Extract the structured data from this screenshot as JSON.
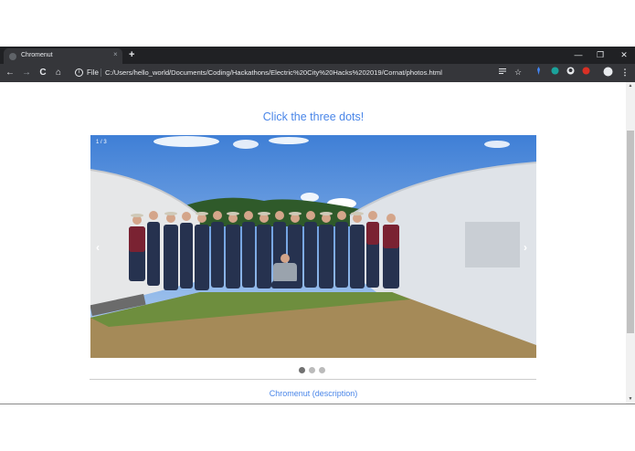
{
  "browser": {
    "tab_title": "Chromenut",
    "tab_close": "×",
    "new_tab": "+",
    "window_controls": {
      "minimize": "—",
      "restore": "❐",
      "close": "✕"
    },
    "nav": {
      "back": "←",
      "forward": "→",
      "reload": "C",
      "home": "⌂"
    },
    "omnibox": {
      "scheme_label": "File",
      "url": "C:/Users/hello_world/Documents/Coding/Hackathons/Electric%20City%20Hacks%202019/Cornat/photos.html"
    },
    "toolbar_icons": [
      "reading-list-icon",
      "star-icon",
      "dropbox-icon",
      "extension-icon",
      "github-icon",
      "extension-red-icon",
      "profile-icon",
      "menu-icon"
    ],
    "menu_glyph": "⋮",
    "star_glyph": "☆"
  },
  "page": {
    "heading": "Click the three dots!",
    "carousel": {
      "counter": "1 / 3",
      "prev": "‹",
      "next": "›",
      "slide_count": 3,
      "active_index": 0
    },
    "description": "Chromenut (description)"
  },
  "colors": {
    "link_blue": "#4a86e8",
    "chrome_dark": "#202124",
    "chrome_toolbar": "#35363a",
    "dot_active": "#717171",
    "dot_inactive": "#bbbbbb"
  }
}
